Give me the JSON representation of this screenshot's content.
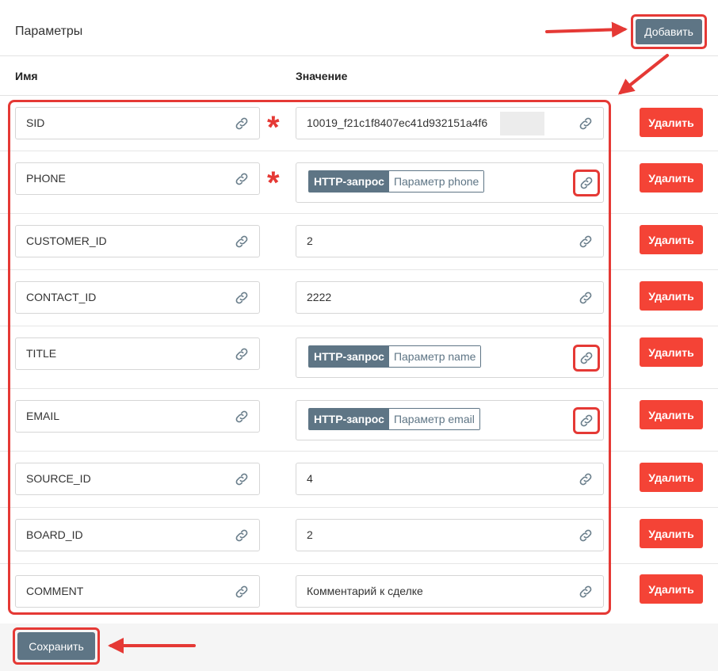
{
  "header": {
    "title": "Параметры",
    "add_label": "Добавить"
  },
  "columns": {
    "name": "Имя",
    "value": "Значение"
  },
  "rows": [
    {
      "name": "SID",
      "value": "10019_f21c1f8407ec41d932151a4f6",
      "required": true
    },
    {
      "name": "PHONE",
      "chip_source": "HTTP-запрос",
      "chip_param": "Параметр phone",
      "required": true
    },
    {
      "name": "CUSTOMER_ID",
      "value": "2"
    },
    {
      "name": "CONTACT_ID",
      "value": "2222"
    },
    {
      "name": "TITLE",
      "chip_source": "HTTP-запрос",
      "chip_param": "Параметр name"
    },
    {
      "name": "EMAIL",
      "chip_source": "HTTP-запрос",
      "chip_param": "Параметр email"
    },
    {
      "name": "SOURCE_ID",
      "value": "4"
    },
    {
      "name": "BOARD_ID",
      "value": "2"
    },
    {
      "name": "COMMENT",
      "value": "Комментарий к сделке"
    }
  ],
  "row_action": {
    "delete_label": "Удалить"
  },
  "footer": {
    "save_label": "Сохранить"
  },
  "icons": {
    "field_link": "link-icon",
    "required_marker": "asterisk-icon"
  },
  "colors": {
    "accent_red": "#f44336",
    "highlight_red": "#e53935",
    "slate": "#5e7585"
  }
}
